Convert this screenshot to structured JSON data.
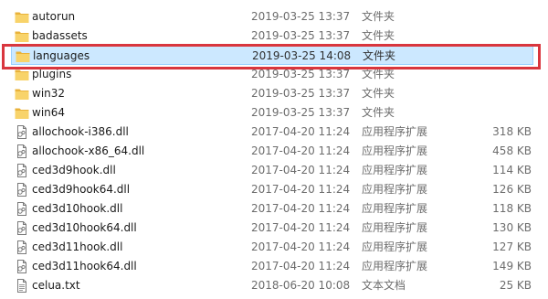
{
  "files": [
    {
      "name": "autorun",
      "date": "2019-03-25 13:37",
      "type": "文件夹",
      "size": "",
      "kind": "folder"
    },
    {
      "name": "badassets",
      "date": "2019-03-25 13:37",
      "type": "文件夹",
      "size": "",
      "kind": "folder"
    },
    {
      "name": "languages",
      "date": "2019-03-25 14:08",
      "type": "文件夹",
      "size": "",
      "kind": "folder",
      "selected": true
    },
    {
      "name": "plugins",
      "date": "2019-03-25 13:37",
      "type": "文件夹",
      "size": "",
      "kind": "folder"
    },
    {
      "name": "win32",
      "date": "2019-03-25 13:37",
      "type": "文件夹",
      "size": "",
      "kind": "folder"
    },
    {
      "name": "win64",
      "date": "2019-03-25 13:37",
      "type": "文件夹",
      "size": "",
      "kind": "folder"
    },
    {
      "name": "allochook-i386.dll",
      "date": "2017-04-20 11:24",
      "type": "应用程序扩展",
      "size": "318 KB",
      "kind": "dll"
    },
    {
      "name": "allochook-x86_64.dll",
      "date": "2017-04-20 11:24",
      "type": "应用程序扩展",
      "size": "458 KB",
      "kind": "dll"
    },
    {
      "name": "ced3d9hook.dll",
      "date": "2017-04-20 11:24",
      "type": "应用程序扩展",
      "size": "114 KB",
      "kind": "dll"
    },
    {
      "name": "ced3d9hook64.dll",
      "date": "2017-04-20 11:24",
      "type": "应用程序扩展",
      "size": "126 KB",
      "kind": "dll"
    },
    {
      "name": "ced3d10hook.dll",
      "date": "2017-04-20 11:24",
      "type": "应用程序扩展",
      "size": "118 KB",
      "kind": "dll"
    },
    {
      "name": "ced3d10hook64.dll",
      "date": "2017-04-20 11:24",
      "type": "应用程序扩展",
      "size": "130 KB",
      "kind": "dll"
    },
    {
      "name": "ced3d11hook.dll",
      "date": "2017-04-20 11:24",
      "type": "应用程序扩展",
      "size": "127 KB",
      "kind": "dll"
    },
    {
      "name": "ced3d11hook64.dll",
      "date": "2017-04-20 11:24",
      "type": "应用程序扩展",
      "size": "149 KB",
      "kind": "dll"
    },
    {
      "name": "celua.txt",
      "date": "2018-06-20 10:08",
      "type": "文本文档",
      "size": "25 KB",
      "kind": "txt"
    }
  ],
  "colors": {
    "folder": "#f4c44e",
    "selection": "#cce8ff",
    "highlight_box": "#d9363e"
  },
  "icons": {
    "folder": "folder-icon",
    "dll": "dll-file-icon",
    "txt": "text-file-icon"
  }
}
